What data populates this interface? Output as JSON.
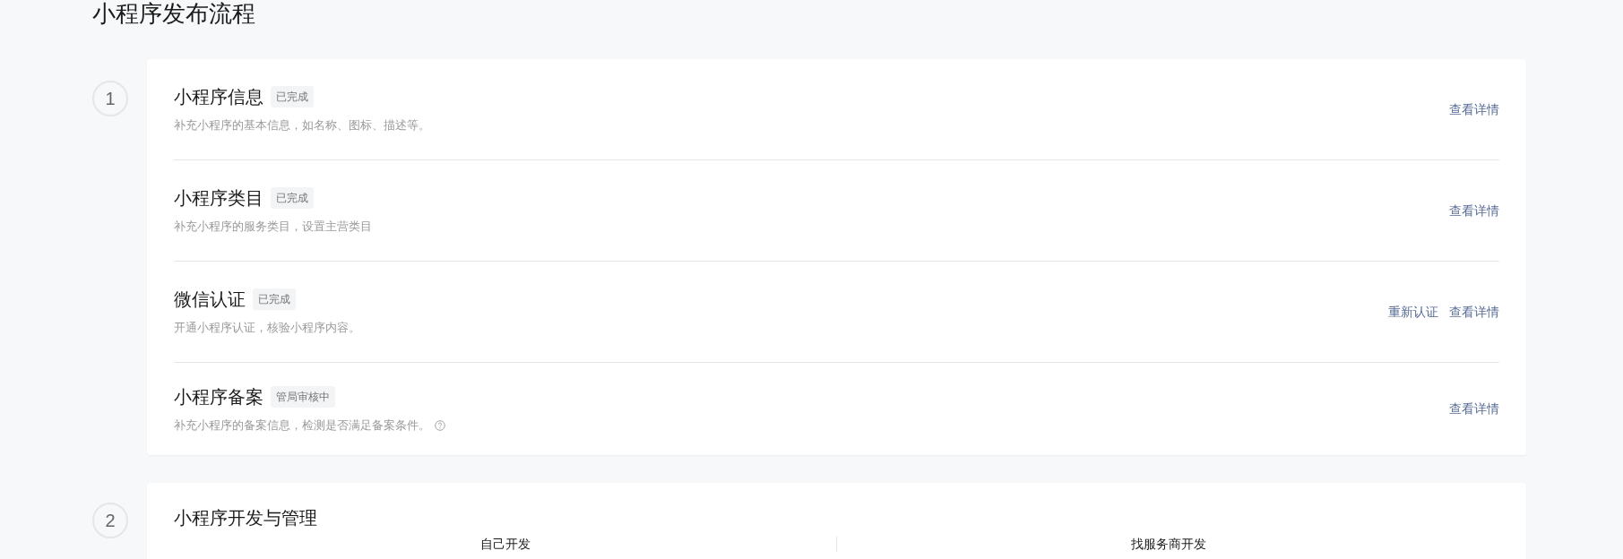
{
  "page_title": "小程序发布流程",
  "steps": [
    {
      "number": "1",
      "items": [
        {
          "title": "小程序信息",
          "tag": "已完成",
          "description": "补充小程序的基本信息，如名称、图标、描述等。",
          "has_help": false,
          "actions": [
            "查看详情"
          ]
        },
        {
          "title": "小程序类目",
          "tag": "已完成",
          "description": "补充小程序的服务类目，设置主营类目",
          "has_help": false,
          "actions": [
            "查看详情"
          ]
        },
        {
          "title": "微信认证",
          "tag": "已完成",
          "description": "开通小程序认证，核验小程序内容。",
          "has_help": false,
          "actions": [
            "重新认证",
            "查看详情"
          ]
        },
        {
          "title": "小程序备案",
          "tag": "管局审核中",
          "description": "补充小程序的备案信息，检测是否满足备案条件。",
          "has_help": true,
          "actions": [
            "查看详情"
          ]
        }
      ]
    },
    {
      "number": "2",
      "title": "小程序开发与管理",
      "options": [
        "自己开发",
        "找服务商开发"
      ]
    }
  ]
}
